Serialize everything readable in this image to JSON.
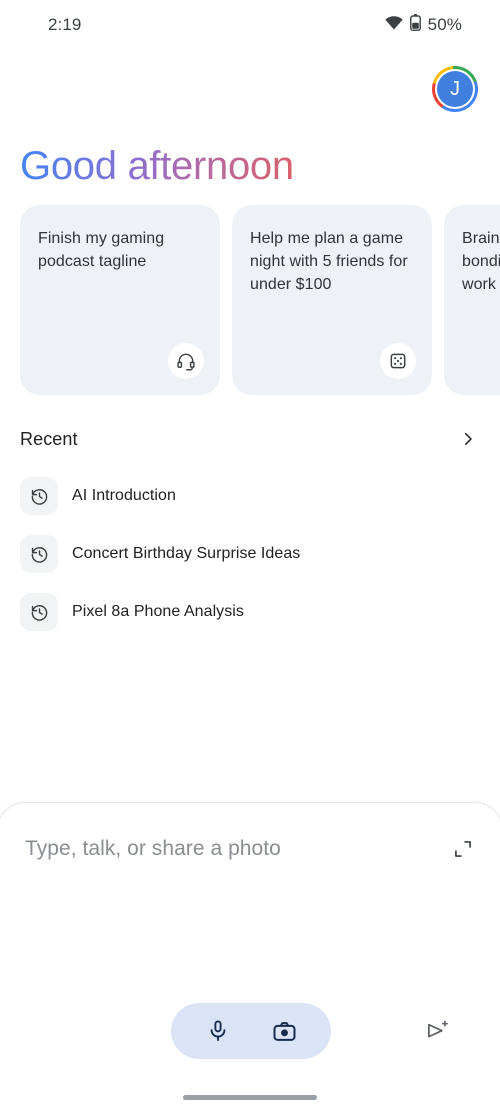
{
  "status_bar": {
    "time": "2:19",
    "battery_percent": "50%",
    "wifi_icon": "wifi-icon",
    "battery_icon": "battery-icon"
  },
  "account": {
    "avatar_initial": "J",
    "avatar_name": "account-avatar",
    "avatar_bg": "#3f7fe0"
  },
  "greeting": {
    "text": "Good afternoon",
    "gradient_from": "#4285f4",
    "gradient_mid": "#8c6fd1",
    "gradient_to": "#d9616a"
  },
  "suggestion_cards": [
    {
      "text": "Finish my gaming podcast tagline",
      "icon": "headset-icon"
    },
    {
      "text": "Help me plan a game night with 5 friends for under $100",
      "icon": "dice-icon"
    },
    {
      "text": "Brainstorm team bonding ideas for a work",
      "icon": "sparkle-icon"
    }
  ],
  "recent": {
    "title": "Recent",
    "more_icon": "chevron-right-icon",
    "items": [
      {
        "label": "AI Introduction",
        "icon": "history-icon"
      },
      {
        "label": "Concert Birthday Surprise Ideas",
        "icon": "history-icon"
      },
      {
        "label": "Pixel 8a Phone Analysis",
        "icon": "history-icon"
      }
    ]
  },
  "composer": {
    "placeholder": "Type, talk, or share a photo",
    "value": "",
    "expand_icon": "expand-icon",
    "mic_icon": "microphone-icon",
    "camera_icon": "camera-icon",
    "send_icon": "send-sparkle-icon",
    "pill_bg": "#dbe4f7"
  },
  "system": {
    "gesture_bar": "gesture-navigation-bar"
  }
}
